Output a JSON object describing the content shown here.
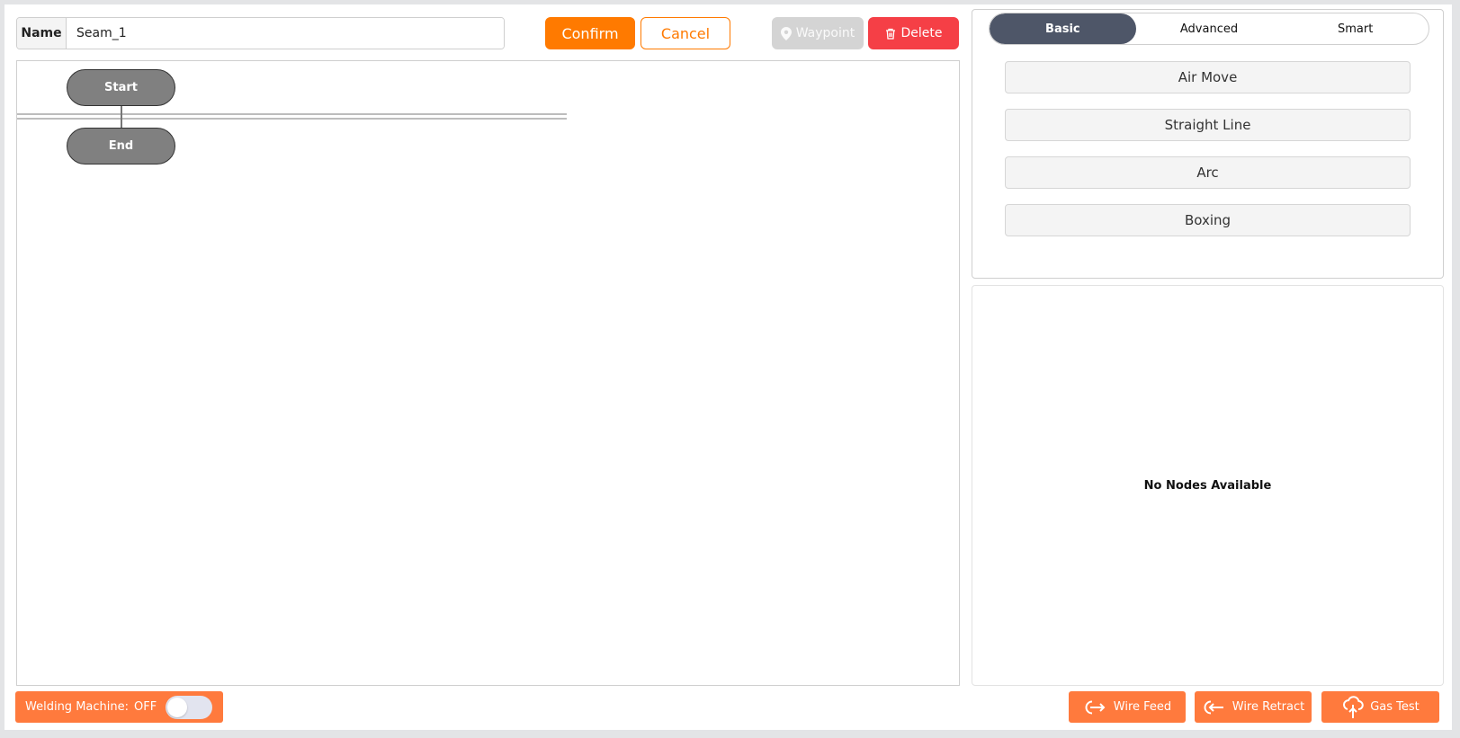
{
  "header": {
    "name_label": "Name",
    "name_value": "Seam_1",
    "confirm_label": "Confirm",
    "cancel_label": "Cancel",
    "waypoint_label": "Waypoint",
    "delete_label": "Delete"
  },
  "flow": {
    "start_label": "Start",
    "end_label": "End"
  },
  "tools": {
    "tabs": [
      "Basic",
      "Advanced",
      "Smart"
    ],
    "active_tab": "Basic",
    "nodes": [
      "Air Move",
      "Straight Line",
      "Arc",
      "Boxing"
    ]
  },
  "nodes_panel": {
    "empty_text": "No Nodes Available"
  },
  "footer": {
    "welding_label": "Welding Machine:",
    "welding_state": "OFF",
    "wire_feed_label": "Wire Feed",
    "wire_retract_label": "Wire Retract",
    "gas_test_label": "Gas Test"
  },
  "colors": {
    "accent": "#ff7a00",
    "action_orange": "#ff7a3d",
    "delete_red": "#f53f46",
    "tab_active": "#4e5668",
    "node_gray": "#808080"
  }
}
